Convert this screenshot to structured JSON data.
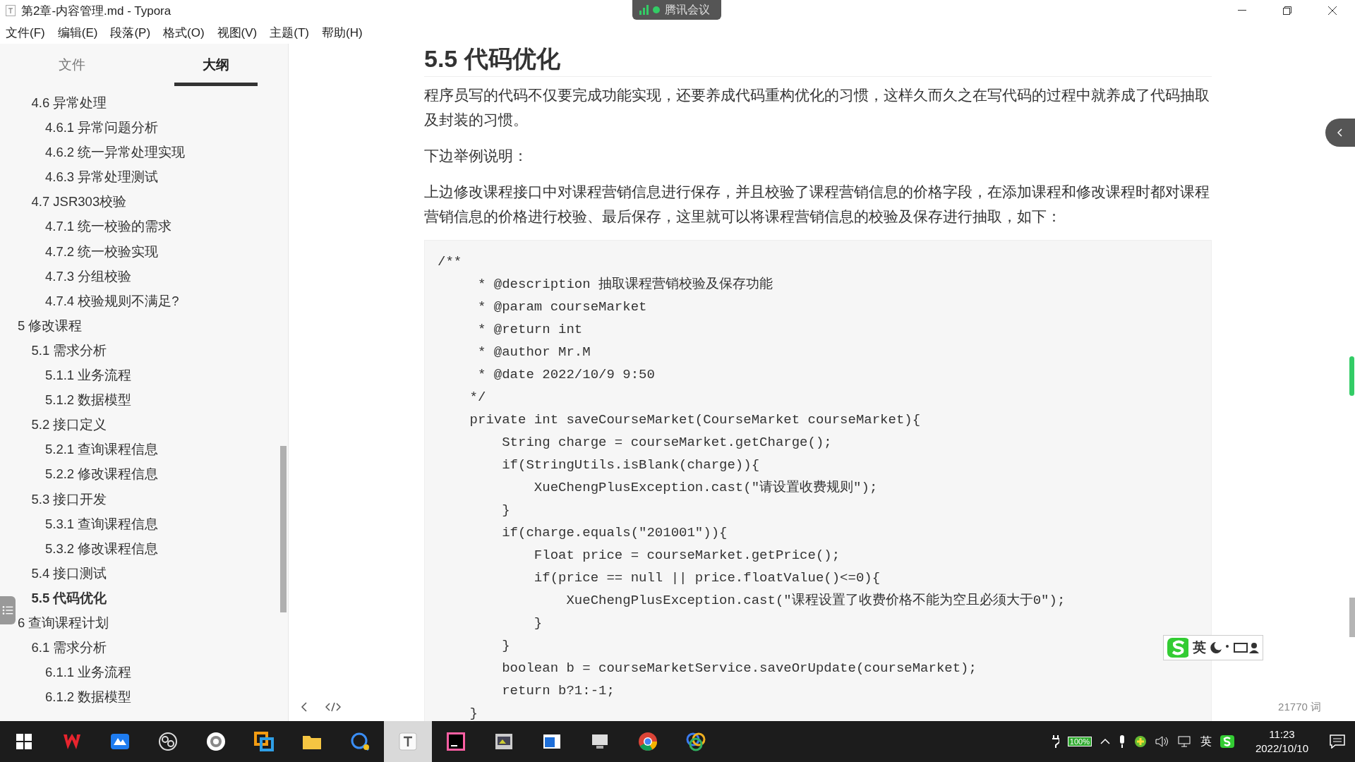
{
  "window": {
    "title": "第2章-内容管理.md - Typora"
  },
  "menu": [
    "文件(F)",
    "编辑(E)",
    "段落(P)",
    "格式(O)",
    "视图(V)",
    "主题(T)",
    "帮助(H)"
  ],
  "meeting_badge": {
    "label": "腾讯会议"
  },
  "sidebar": {
    "tabs": [
      {
        "label": "文件",
        "selected": false
      },
      {
        "label": "大纲",
        "selected": true
      }
    ],
    "outline": [
      {
        "children": [
          {
            "label": "4.6 异常处理",
            "selected": false,
            "children": [
              {
                "label": "4.6.1 异常问题分析",
                "selected": false
              },
              {
                "label": "4.6.2 统一异常处理实现",
                "selected": false
              },
              {
                "label": "4.6.3 异常处理测试",
                "selected": false
              }
            ]
          },
          {
            "label": "4.7 JSR303校验",
            "selected": false,
            "children": [
              {
                "label": "4.7.1 统一校验的需求",
                "selected": false
              },
              {
                "label": "4.7.2 统一校验实现",
                "selected": false
              },
              {
                "label": "4.7.3 分组校验",
                "selected": false
              },
              {
                "label": "4.7.4 校验规则不满足?",
                "selected": false
              }
            ]
          }
        ]
      },
      {
        "label": "5 修改课程",
        "selected": false,
        "children": [
          {
            "label": "5.1 需求分析",
            "selected": false,
            "children": [
              {
                "label": "5.1.1 业务流程",
                "selected": false
              },
              {
                "label": "5.1.2 数据模型",
                "selected": false
              }
            ]
          },
          {
            "label": "5.2 接口定义",
            "selected": false,
            "children": [
              {
                "label": "5.2.1 查询课程信息",
                "selected": false
              },
              {
                "label": "5.2.2 修改课程信息",
                "selected": false
              }
            ]
          },
          {
            "label": "5.3 接口开发",
            "selected": false,
            "children": [
              {
                "label": "5.3.1 查询课程信息",
                "selected": false
              },
              {
                "label": "5.3.2 修改课程信息",
                "selected": false
              }
            ]
          },
          {
            "label": "5.4 接口测试",
            "selected": false
          },
          {
            "label": "5.5 代码优化",
            "selected": true
          }
        ]
      },
      {
        "label": "6 查询课程计划",
        "selected": false,
        "children": [
          {
            "label": "6.1 需求分析",
            "selected": false,
            "children": [
              {
                "label": "6.1.1 业务流程",
                "selected": false
              },
              {
                "label": "6.1.2 数据模型",
                "selected": false
              }
            ]
          }
        ]
      }
    ]
  },
  "document": {
    "heading": "5.5 代码优化",
    "paragraphs": [
      "程序员写的代码不仅要完成功能实现，还要养成代码重构优化的习惯，这样久而久之在写代码的过程中就养成了代码抽取及封装的习惯。",
      "下边举例说明：",
      "上边修改课程接口中对课程营销信息进行保存，并且校验了课程营销信息的价格字段，在添加课程和修改课程时都对课程营销信息的价格进行校验、最后保存，这里就可以将课程营销信息的校验及保存进行抽取，如下："
    ],
    "code": [
      "/**",
      "     * @description 抽取课程营销校验及保存功能",
      "     * @param courseMarket",
      "     * @return int",
      "     * @author Mr.M",
      "     * @date 2022/10/9 9:50",
      "    */",
      "    private int saveCourseMarket(CourseMarket courseMarket){",
      "        String charge = courseMarket.getCharge();",
      "        if(StringUtils.isBlank(charge)){",
      "            XueChengPlusException.cast(\"请设置收费规则\");",
      "        }",
      "        if(charge.equals(\"201001\")){",
      "            Float price = courseMarket.getPrice();",
      "            if(price == null || price.floatValue()<=0){",
      "                XueChengPlusException.cast(\"课程设置了收费价格不能为空且必须大于0\");",
      "            }",
      "        }",
      "        boolean b = courseMarketService.saveOrUpdate(courseMarket);",
      "        return b?1:-1;",
      "    }"
    ]
  },
  "status": {
    "word_count": "21770 词"
  },
  "ime_bar": {
    "mode": "英"
  },
  "taskbar": {
    "apps": [
      {
        "kind": "windows",
        "selected": false
      },
      {
        "kind": "wps",
        "selected": false
      },
      {
        "kind": "cloud",
        "selected": false
      },
      {
        "kind": "ring",
        "selected": false
      },
      {
        "kind": "disc",
        "selected": false
      },
      {
        "kind": "squares",
        "selected": false
      },
      {
        "kind": "folder",
        "selected": false
      },
      {
        "kind": "chat",
        "selected": false
      },
      {
        "kind": "typora",
        "selected": true
      },
      {
        "kind": "idea",
        "selected": false
      },
      {
        "kind": "image",
        "selected": false
      },
      {
        "kind": "window",
        "selected": false
      },
      {
        "kind": "computer",
        "selected": false
      },
      {
        "kind": "chrome",
        "selected": false
      },
      {
        "kind": "circles",
        "selected": false
      }
    ],
    "battery": "100%",
    "input_lang": "英",
    "time": "11:23",
    "date": "2022/10/10"
  }
}
